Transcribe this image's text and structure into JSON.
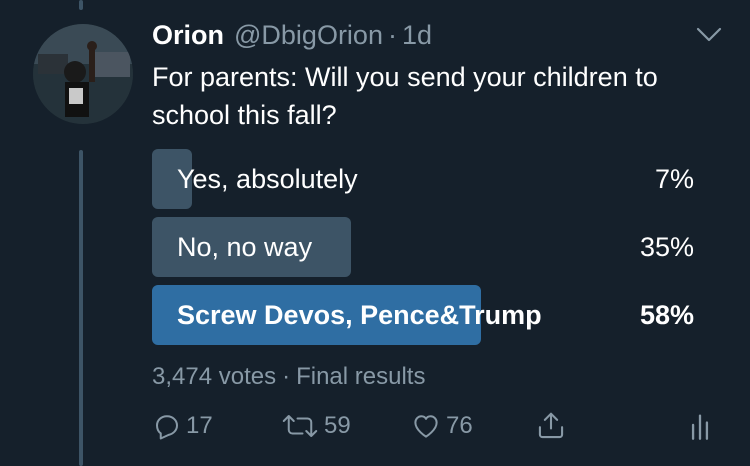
{
  "tweet": {
    "author_name": "Orion",
    "handle": "@DbigOrion",
    "separator": "·",
    "time": "1d",
    "text": "For parents: Will you send your children to school this fall?"
  },
  "poll": {
    "options": [
      {
        "label": "Yes, absolutely",
        "percent_text": "7%",
        "percent": 7
      },
      {
        "label": "No, no way",
        "percent_text": "35%",
        "percent": 35
      },
      {
        "label": "Screw Devos, Pence&Trump",
        "percent_text": "58%",
        "percent": 58
      }
    ],
    "votes": "3,474 votes",
    "meta_separator": "·",
    "status": "Final results"
  },
  "actions": {
    "reply_count": "17",
    "retweet_count": "59",
    "like_count": "76"
  },
  "colors": {
    "background": "#15202b",
    "bar": "#3d5466",
    "winning_bar": "#2f6ea3",
    "secondary_text": "#8899a6"
  },
  "icons": [
    "avatar-photo",
    "chevron-down-icon",
    "reply-icon",
    "retweet-icon",
    "like-icon",
    "share-icon",
    "analytics-icon"
  ]
}
